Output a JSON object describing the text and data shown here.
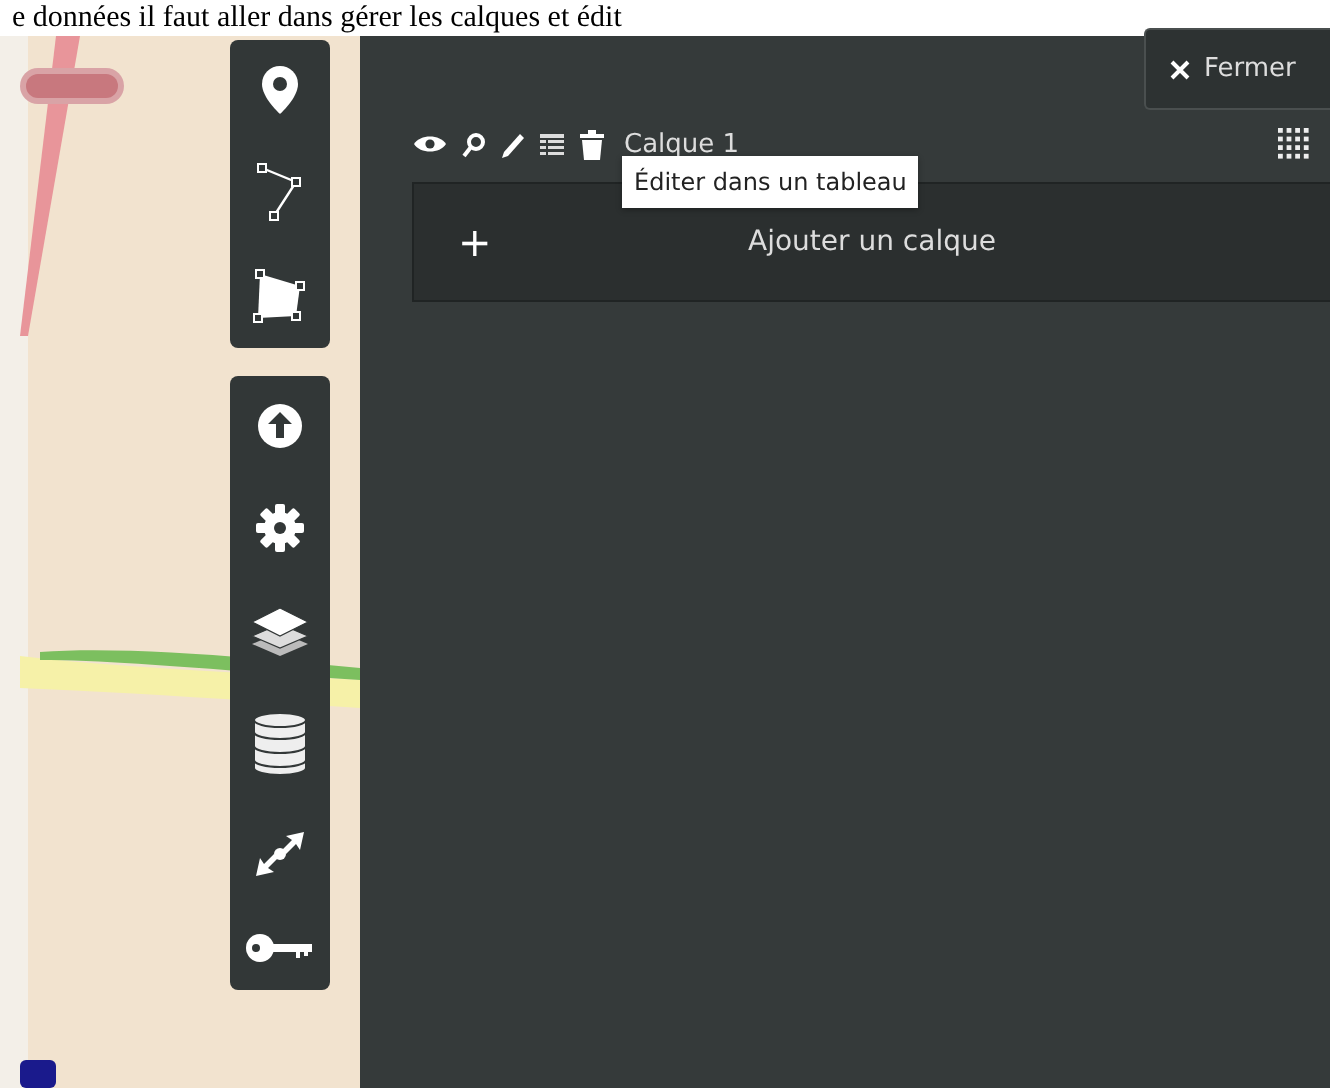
{
  "caption": "e données il faut aller dans gérer les calques et édit",
  "close_button": {
    "label": "Fermer"
  },
  "layers": [
    {
      "name": "Calque 1"
    }
  ],
  "tooltip": "Éditer dans un tableau",
  "add_layer": {
    "icon": "+",
    "label": "Ajouter un calque"
  }
}
